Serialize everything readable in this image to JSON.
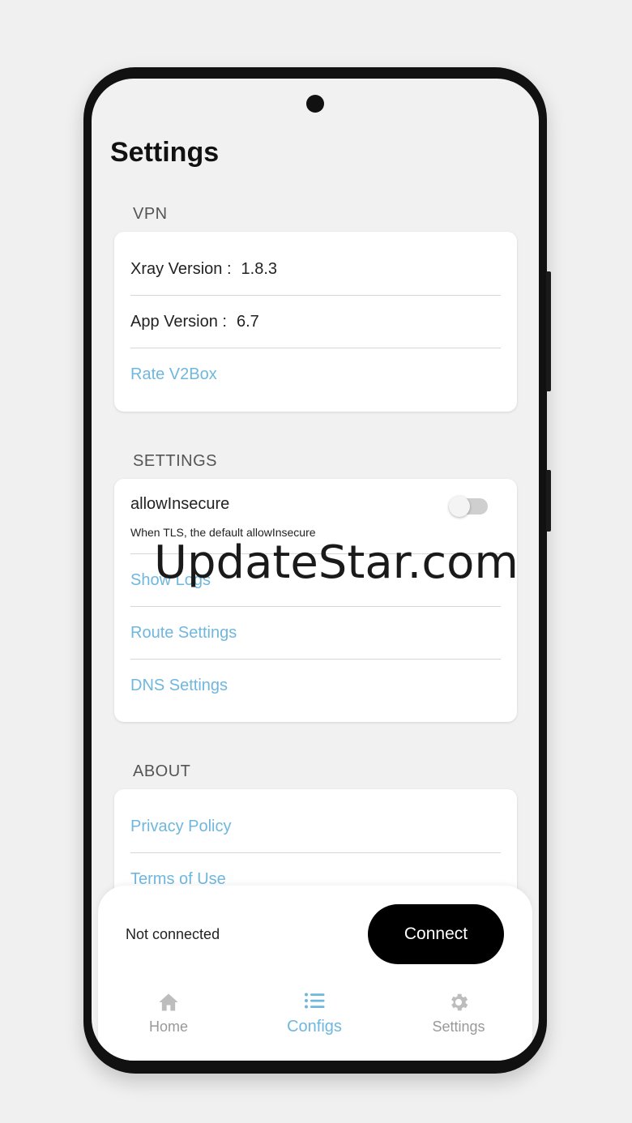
{
  "page_title": "Settings",
  "sections": {
    "vpn": {
      "title": "VPN",
      "xray_label": "Xray Version :",
      "xray_value": "1.8.3",
      "app_label": "App Version :",
      "app_value": "6.7",
      "rate_label": "Rate V2Box"
    },
    "settings": {
      "title": "SETTINGS",
      "allow_insecure_label": "allowInsecure",
      "allow_insecure_desc": "When TLS, the default allowInsecure",
      "allow_insecure_enabled": false,
      "show_logs": "Show Logs",
      "route_settings": "Route Settings",
      "dns_settings": "DNS Settings"
    },
    "about": {
      "title": "ABOUT",
      "privacy_policy": "Privacy Policy",
      "terms_of_use": "Terms of Use"
    }
  },
  "watermark": "UpdateStar.com",
  "connection": {
    "status": "Not connected",
    "button_label": "Connect"
  },
  "nav": {
    "home": "Home",
    "configs": "Configs",
    "settings": "Settings",
    "active": "configs"
  },
  "colors": {
    "accent": "#6fb7dd",
    "nav_inactive": "#999999",
    "button_bg": "#000000"
  }
}
